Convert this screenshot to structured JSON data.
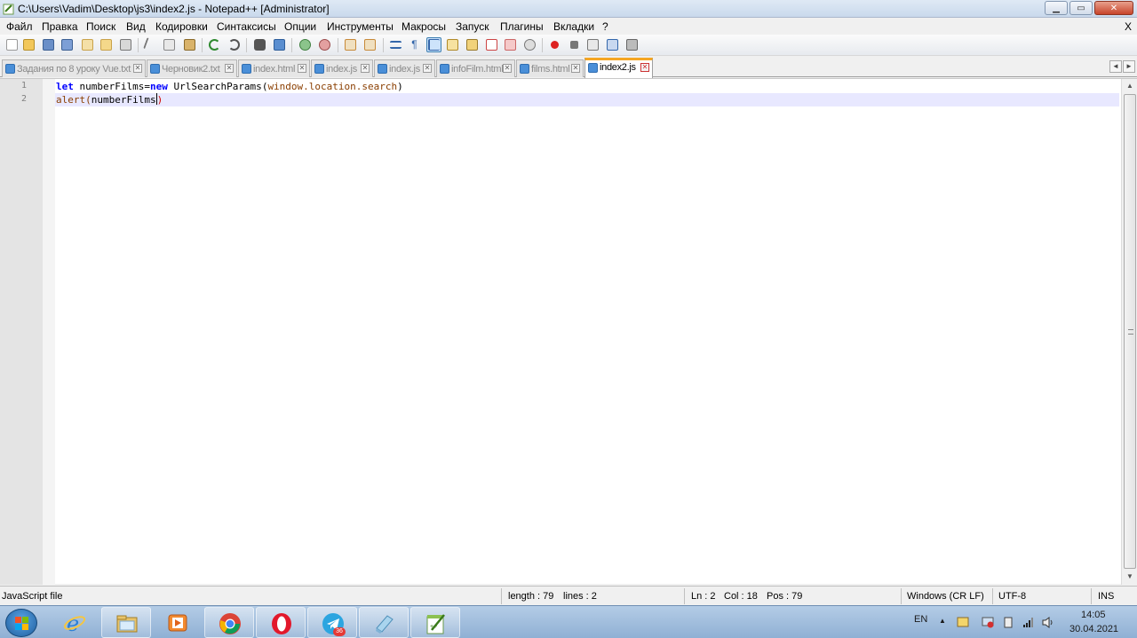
{
  "window": {
    "title": "C:\\Users\\Vadim\\Desktop\\js3\\index2.js - Notepad++ [Administrator]",
    "minimize_glyph": "▁",
    "maximize_glyph": "▭",
    "close_glyph": "✕"
  },
  "menu": {
    "items": [
      "Файл",
      "Правка",
      "Поиск",
      "Вид",
      "Кодировки",
      "Синтаксисы",
      "Опции",
      "Инструменты",
      "Макросы",
      "Запуск",
      "Плагины",
      "Вкладки",
      "?"
    ],
    "close_label": "X"
  },
  "toolbar": {
    "buttons": [
      "new-file-icon",
      "open-file-icon",
      "save-icon",
      "save-all-icon",
      "close-icon",
      "close-all-icon",
      "print-icon",
      "cut-icon",
      "copy-icon",
      "paste-icon",
      "undo-icon",
      "redo-icon",
      "find-icon",
      "replace-icon",
      "zoom-in-icon",
      "zoom-out-icon",
      "sync-vertical-icon",
      "sync-horizontal-icon",
      "word-wrap-icon",
      "show-all-chars-icon",
      "indent-guide-icon",
      "user-lang-icon",
      "doc-map-icon",
      "function-list-icon",
      "folder-workspace-icon",
      "monitoring-icon",
      "record-macro-icon",
      "stop-macro-icon",
      "play-macro-icon",
      "run-macro-multiple-icon",
      "save-macro-icon"
    ]
  },
  "tabs": [
    {
      "label": "Задания по 8 уроку Vue.txt",
      "active": false
    },
    {
      "label": "Черновик2.txt",
      "active": false
    },
    {
      "label": "index.html",
      "active": false
    },
    {
      "label": "index.js",
      "active": false
    },
    {
      "label": "index.js",
      "active": false
    },
    {
      "label": "infoFilm.html",
      "active": false
    },
    {
      "label": "films.html",
      "active": false
    },
    {
      "label": "index2.js",
      "active": true
    }
  ],
  "tab_nav": {
    "prev": "◄",
    "next": "►"
  },
  "editor": {
    "line_numbers": [
      "1",
      "2"
    ],
    "line1": {
      "kw1": "let",
      "t1": " numberFilms=",
      "kw2": "new",
      "t2": " UrlSearchParams",
      "t3": "(",
      "t4": "window.location.search",
      "t5": ")"
    },
    "line2": {
      "fn": "alert",
      "t1": "(",
      "t2": "numberFilms",
      "t3": ")"
    },
    "current_line": 2,
    "scroll_up": "▲",
    "scroll_down": "▼"
  },
  "status": {
    "file_type": "JavaScript file",
    "length": "length : 79",
    "lines": "lines : 2",
    "ln": "Ln : 2",
    "col": "Col : 18",
    "pos": "Pos : 79",
    "eol": "Windows (CR LF)",
    "encoding": "UTF-8",
    "mode": "INS"
  },
  "taskbar": {
    "apps": [
      "internet-explorer-icon",
      "file-explorer-icon",
      "media-player-icon",
      "chrome-icon",
      "opera-icon",
      "telegram-icon",
      "notepad-icon",
      "notepadpp-icon"
    ],
    "telegram_badge": "36",
    "language": "EN",
    "time": "14:05",
    "date": "30.04.2021",
    "tray_arrow": "▲"
  },
  "colors": {
    "keyword": "#0000ff",
    "function": "#8a3e00",
    "current_line": "#e8e8ff",
    "active_tab_accent": "#f5a623"
  }
}
